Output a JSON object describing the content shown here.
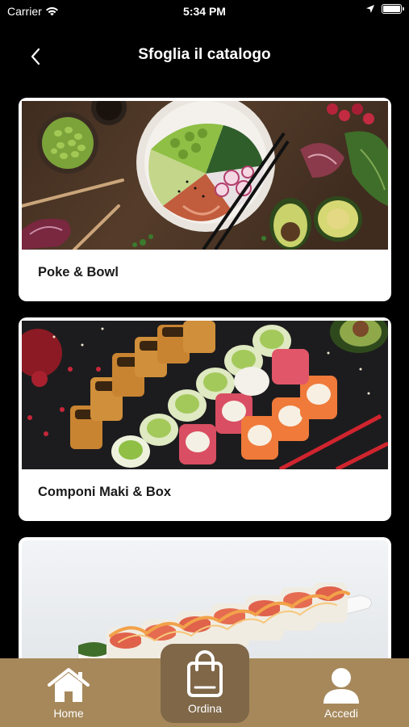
{
  "status_bar": {
    "carrier": "Carrier",
    "time": "5:34 PM",
    "icons": [
      "wifi-icon",
      "location-arrow-icon",
      "battery-icon"
    ]
  },
  "nav": {
    "title": "Sfoglia il catalogo",
    "back_icon": "chevron-left-icon"
  },
  "catalog": {
    "items": [
      {
        "label": "Poke & Bowl",
        "image": "poke bowl with edamame, salmon, radish and chopsticks"
      },
      {
        "label": "Componi Maki & Box",
        "image": "assorted maki rolls on black slate with chopsticks"
      },
      {
        "label": "",
        "image": "sushi roll with sauce on white plate"
      }
    ]
  },
  "tab_bar": {
    "background": "#a6885b",
    "active_background": "#7f6748",
    "tabs": [
      {
        "label": "Home",
        "icon": "home-icon"
      },
      {
        "label": "Ordina",
        "icon": "shopping-bag-icon",
        "active": true
      },
      {
        "label": "Accedi",
        "icon": "user-icon"
      }
    ]
  }
}
